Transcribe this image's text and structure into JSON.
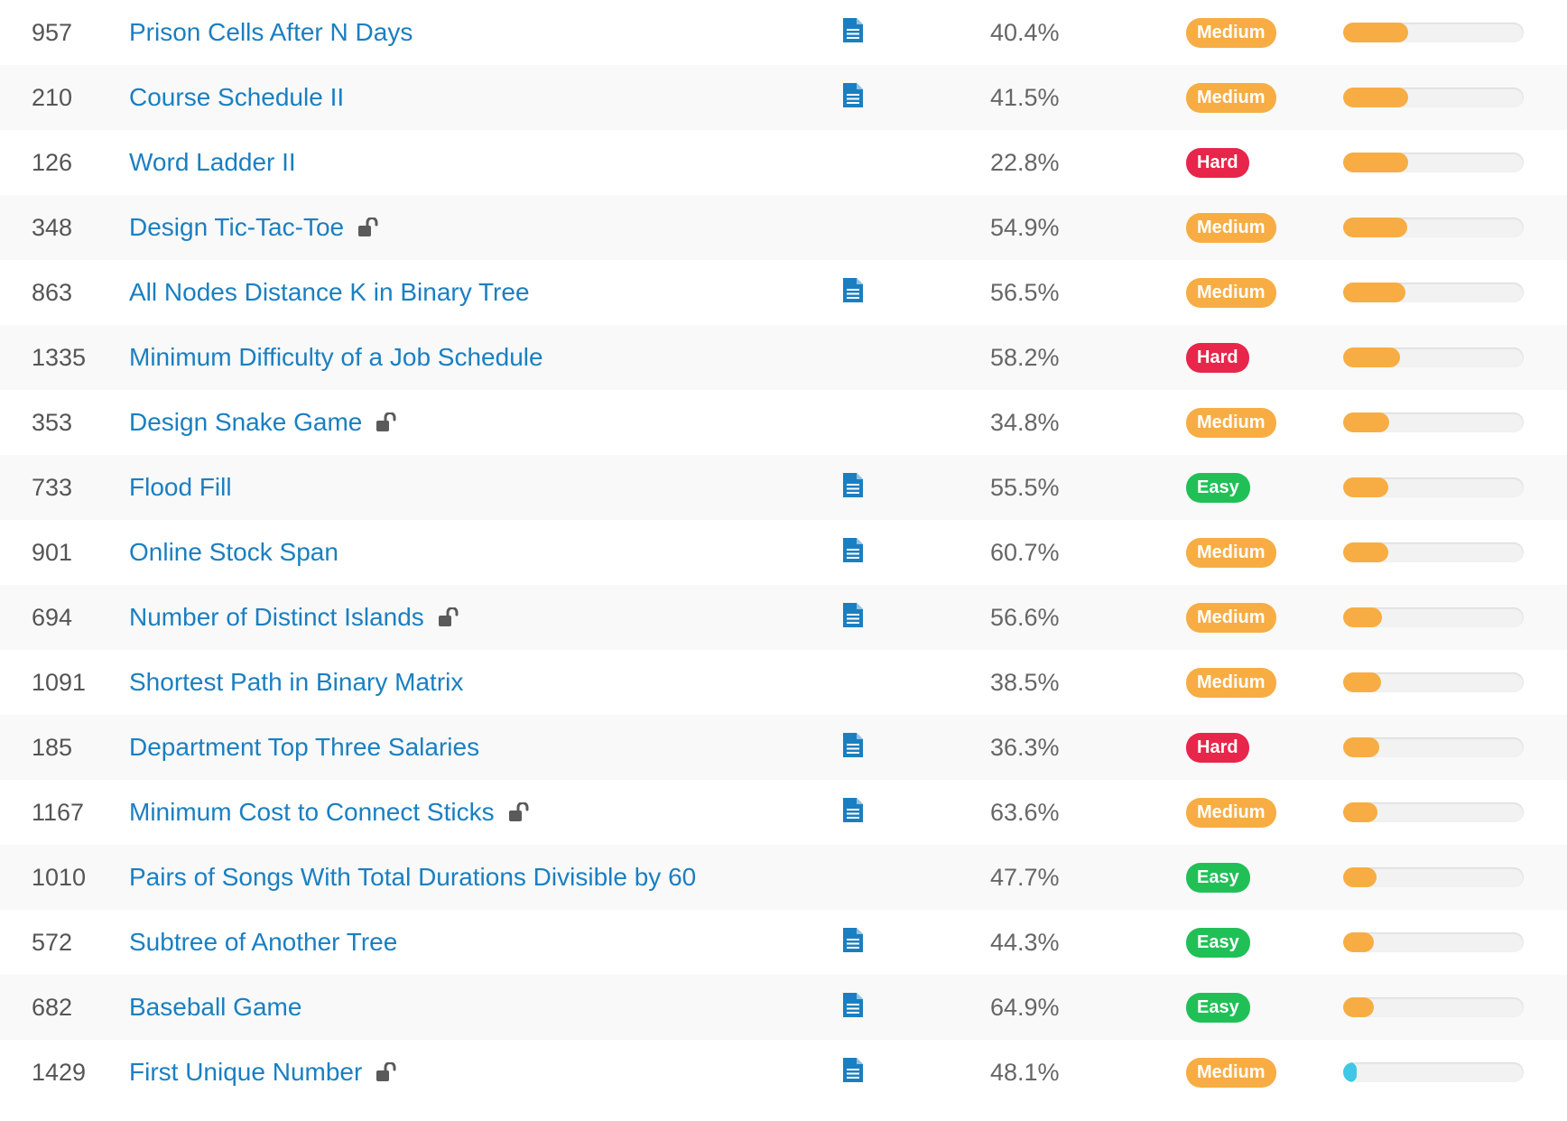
{
  "colors": {
    "link": "#1a7fc1",
    "Medium": "#f7ad43",
    "Hard": "#e8254b",
    "Easy": "#20c057",
    "bar_orange": "#f7ad43",
    "bar_cyan": "#3ec8e6"
  },
  "icons": {
    "solution": "document-icon",
    "locked": "unlock-icon"
  },
  "problems": [
    {
      "id": "957",
      "title": "Prison Cells After N Days",
      "locked": false,
      "solution": true,
      "acceptance": "40.4%",
      "difficulty": "Medium",
      "frequency": 0.36,
      "bar_color": "orange"
    },
    {
      "id": "210",
      "title": "Course Schedule II",
      "locked": false,
      "solution": true,
      "acceptance": "41.5%",
      "difficulty": "Medium",
      "frequency": 0.36,
      "bar_color": "orange"
    },
    {
      "id": "126",
      "title": "Word Ladder II",
      "locked": false,
      "solution": false,
      "acceptance": "22.8%",
      "difficulty": "Hard",
      "frequency": 0.36,
      "bar_color": "orange"
    },
    {
      "id": "348",
      "title": "Design Tic-Tac-Toe",
      "locked": true,
      "solution": false,
      "acceptance": "54.9%",
      "difficulty": "Medium",
      "frequency": 0.355,
      "bar_color": "orange"
    },
    {
      "id": "863",
      "title": "All Nodes Distance K in Binary Tree",
      "locked": false,
      "solution": true,
      "acceptance": "56.5%",
      "difficulty": "Medium",
      "frequency": 0.345,
      "bar_color": "orange"
    },
    {
      "id": "1335",
      "title": "Minimum Difficulty of a Job Schedule",
      "locked": false,
      "solution": false,
      "acceptance": "58.2%",
      "difficulty": "Hard",
      "frequency": 0.315,
      "bar_color": "orange"
    },
    {
      "id": "353",
      "title": "Design Snake Game",
      "locked": true,
      "solution": false,
      "acceptance": "34.8%",
      "difficulty": "Medium",
      "frequency": 0.255,
      "bar_color": "orange"
    },
    {
      "id": "733",
      "title": "Flood Fill",
      "locked": false,
      "solution": true,
      "acceptance": "55.5%",
      "difficulty": "Easy",
      "frequency": 0.25,
      "bar_color": "orange"
    },
    {
      "id": "901",
      "title": "Online Stock Span",
      "locked": false,
      "solution": true,
      "acceptance": "60.7%",
      "difficulty": "Medium",
      "frequency": 0.25,
      "bar_color": "orange"
    },
    {
      "id": "694",
      "title": "Number of Distinct Islands",
      "locked": true,
      "solution": true,
      "acceptance": "56.6%",
      "difficulty": "Medium",
      "frequency": 0.215,
      "bar_color": "orange"
    },
    {
      "id": "1091",
      "title": "Shortest Path in Binary Matrix",
      "locked": false,
      "solution": false,
      "acceptance": "38.5%",
      "difficulty": "Medium",
      "frequency": 0.21,
      "bar_color": "orange"
    },
    {
      "id": "185",
      "title": "Department Top Three Salaries",
      "locked": false,
      "solution": true,
      "acceptance": "36.3%",
      "difficulty": "Hard",
      "frequency": 0.2,
      "bar_color": "orange"
    },
    {
      "id": "1167",
      "title": "Minimum Cost to Connect Sticks",
      "locked": true,
      "solution": true,
      "acceptance": "63.6%",
      "difficulty": "Medium",
      "frequency": 0.19,
      "bar_color": "orange"
    },
    {
      "id": "1010",
      "title": "Pairs of Songs With Total Durations Divisible by 60",
      "locked": false,
      "solution": false,
      "acceptance": "47.7%",
      "difficulty": "Easy",
      "frequency": 0.185,
      "bar_color": "orange"
    },
    {
      "id": "572",
      "title": "Subtree of Another Tree",
      "locked": false,
      "solution": true,
      "acceptance": "44.3%",
      "difficulty": "Easy",
      "frequency": 0.17,
      "bar_color": "orange"
    },
    {
      "id": "682",
      "title": "Baseball Game",
      "locked": false,
      "solution": true,
      "acceptance": "64.9%",
      "difficulty": "Easy",
      "frequency": 0.17,
      "bar_color": "orange"
    },
    {
      "id": "1429",
      "title": "First Unique Number",
      "locked": true,
      "solution": true,
      "acceptance": "48.1%",
      "difficulty": "Medium",
      "frequency": 0.075,
      "bar_color": "cyan"
    }
  ]
}
